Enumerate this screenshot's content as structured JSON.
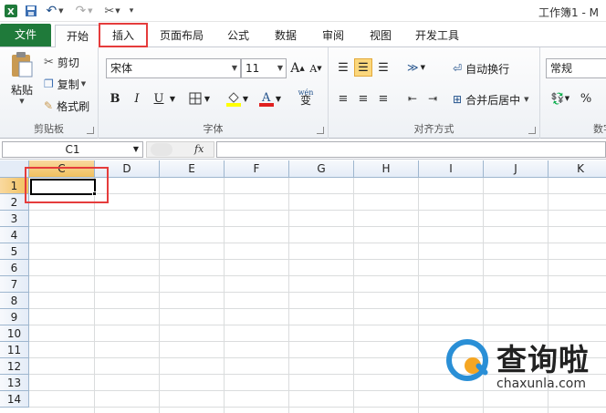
{
  "window": {
    "title": "工作簿1 - M"
  },
  "tabs": [
    {
      "label": "文件"
    },
    {
      "label": "开始"
    },
    {
      "label": "插入"
    },
    {
      "label": "页面布局"
    },
    {
      "label": "公式"
    },
    {
      "label": "数据"
    },
    {
      "label": "审阅"
    },
    {
      "label": "视图"
    },
    {
      "label": "开发工具"
    }
  ],
  "clipboard": {
    "paste_label": "粘贴",
    "cut_label": "剪切",
    "copy_label": "复制",
    "format_painter_label": "格式刷",
    "group_label": "剪贴板"
  },
  "font": {
    "name": "宋体",
    "size": "11",
    "grow_label": "A",
    "shrink_label": "A",
    "bold_label": "B",
    "italic_label": "I",
    "underline_label": "U",
    "phonetic_label": "wén",
    "group_label": "字体"
  },
  "alignment": {
    "wrap_text_label": "自动换行",
    "merge_center_label": "合并后居中",
    "group_label": "对齐方式"
  },
  "number": {
    "format": "常规",
    "percent_label": "%",
    "group_label": "数字"
  },
  "formula_bar": {
    "name_box": "C1",
    "fx_label": "fx",
    "value": ""
  },
  "grid": {
    "columns": [
      "C",
      "D",
      "E",
      "F",
      "G",
      "H",
      "I",
      "J",
      "K"
    ],
    "rows": [
      "1",
      "2",
      "3",
      "4",
      "5",
      "6",
      "7",
      "8",
      "9",
      "10",
      "11",
      "12",
      "13",
      "14"
    ],
    "active_cell": "C1"
  },
  "colors": {
    "file_tab": "#1f7a3a",
    "highlight": "#e53c3c",
    "selected_header": "#f1c15f"
  },
  "watermark": {
    "title": "查询啦",
    "url": "chaxunla.com"
  }
}
